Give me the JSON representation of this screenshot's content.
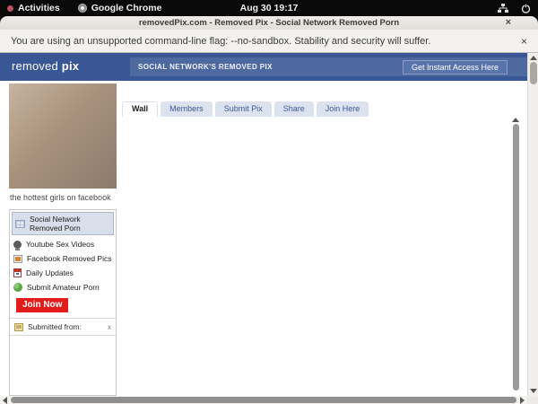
{
  "gnome_bar": {
    "activities": "Activities",
    "app_name": "Google Chrome",
    "clock": "Aug 30 19:17",
    "right_icons": [
      "wired-network-icon",
      "power-icon"
    ]
  },
  "window": {
    "title": "removedPix.com - Removed Pix - Social Network Removed Porn",
    "close_glyph": "×"
  },
  "infobar": {
    "message": "You are using an unsupported command-line flag: --no-sandbox. Stability and security will suffer.",
    "close_glyph": "×"
  },
  "site": {
    "logo_word1": "removed ",
    "logo_word2": "pix",
    "banner": "SOCIAL NETWORK'S REMOVED PIX",
    "access_button": "Get Instant Access Here",
    "colors": {
      "header_blue": "#3a5795",
      "banner_blue": "#4e68a0",
      "tab_blue": "#3b5998",
      "tab_inactive_bg": "#dce3ee",
      "selected_item_bg": "#d8dfea",
      "join_red": "#e31b1b"
    }
  },
  "sidebar": {
    "caption": "the hottest girls on facebook",
    "menu": [
      {
        "label": "Social Network Removed Porn",
        "icon": "grid-wall-icon",
        "selected": true
      },
      {
        "label": "Youtube Sex Videos",
        "icon": "webcam-icon",
        "selected": false
      },
      {
        "label": "Facebook Removed Pics",
        "icon": "photo-icon",
        "selected": false
      },
      {
        "label": "Daily Updates",
        "icon": "calendar-icon",
        "selected": false
      },
      {
        "label": "Submit Amateur Porn",
        "icon": "green-globe-icon",
        "selected": false
      }
    ],
    "join_button": "Join Now",
    "submitted_row": {
      "label": "Submitted from:",
      "icon": "polaroid-icon",
      "close_glyph": "x"
    }
  },
  "tabs": [
    {
      "label": "Wall",
      "active": true
    },
    {
      "label": "Members",
      "active": false
    },
    {
      "label": "Submit Pix",
      "active": false
    },
    {
      "label": "Share",
      "active": false
    },
    {
      "label": "Join Here",
      "active": false
    }
  ]
}
